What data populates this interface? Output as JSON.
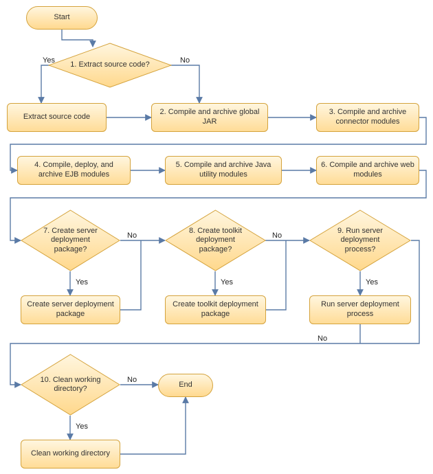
{
  "diagram": {
    "start": "Start",
    "end": "End",
    "d1": {
      "label": "1. Extract source code?",
      "yes": "Yes",
      "no": "No"
    },
    "p_extract": "Extract source code",
    "p2": "2. Compile and archive global JAR",
    "p3": "3. Compile and archive connector modules",
    "p4": "4. Compile, deploy, and archive EJB modules",
    "p5": "5. Compile and archive Java utility modules",
    "p6": "6. Compile and archive web modules",
    "d7": {
      "label": "7. Create server deployment package?",
      "yes": "Yes",
      "no": "No"
    },
    "p7": "Create server deployment package",
    "d8": {
      "label": "8. Create toolkit deployment package?",
      "yes": "Yes",
      "no": "No"
    },
    "p8": "Create toolkit deployment package",
    "d9": {
      "label": "9. Run server deployment process?",
      "yes": "Yes",
      "no": "No"
    },
    "p9": "Run server deployment process",
    "d10": {
      "label": "10. Clean working directory?",
      "yes": "Yes",
      "no": "No"
    },
    "p10": "Clean working directory"
  }
}
